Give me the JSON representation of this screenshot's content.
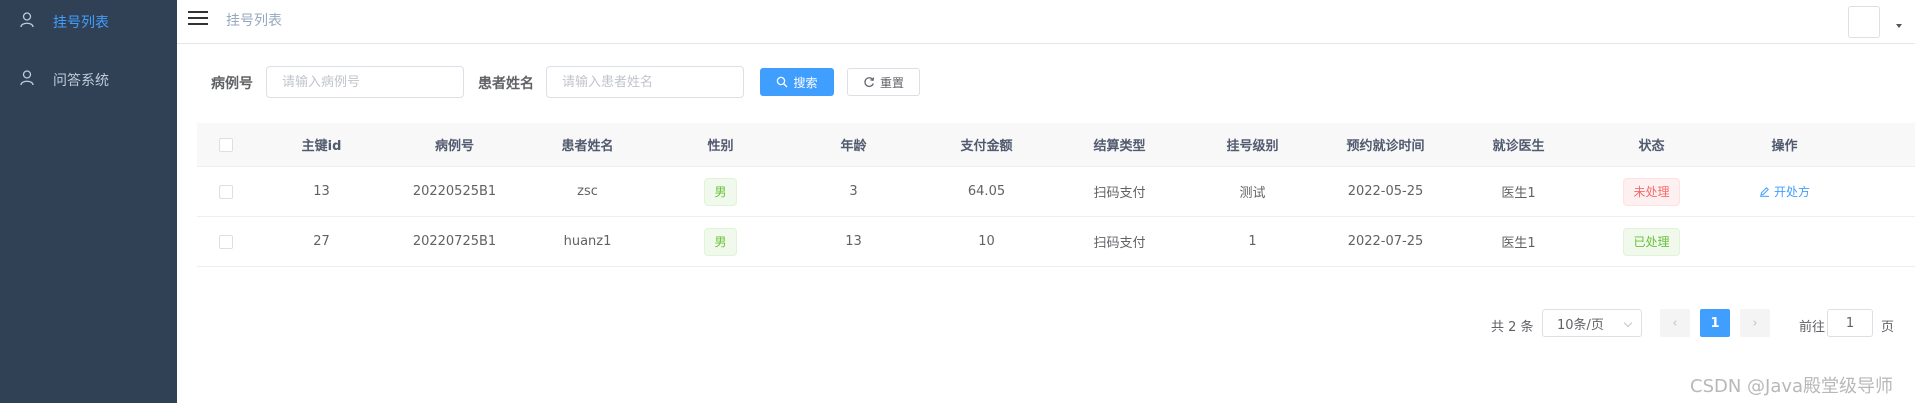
{
  "sidebar": {
    "items": [
      {
        "label": "挂号列表",
        "icon": "user-icon",
        "active": true
      },
      {
        "label": "问答系统",
        "icon": "user-icon",
        "active": false
      }
    ],
    "bg_color": "#304156",
    "active_color": "#409eff"
  },
  "navbar": {
    "breadcrumb": "挂号列表"
  },
  "search": {
    "case_label": "病例号",
    "case_placeholder": "请输入病例号",
    "case_value": "",
    "name_label": "患者姓名",
    "name_placeholder": "请输入患者姓名",
    "name_value": "",
    "search_button": "搜索",
    "reset_button": "重置"
  },
  "table": {
    "headers": [
      "主键id",
      "病例号",
      "患者姓名",
      "性别",
      "年龄",
      "支付金额",
      "结算类型",
      "挂号级别",
      "预约就诊时间",
      "就诊医生",
      "状态",
      "操作"
    ],
    "rows": [
      {
        "id": "13",
        "case_no": "20220525B1",
        "name": "zsc",
        "gender": "男",
        "age": "3",
        "amount": "64.05",
        "settle_type": "扫码支付",
        "level": "测试",
        "time": "2022-05-25",
        "doctor": "医生1",
        "status": "未处理",
        "status_type": "danger",
        "action": "开处方"
      },
      {
        "id": "27",
        "case_no": "20220725B1",
        "name": "huanz1",
        "gender": "男",
        "age": "13",
        "amount": "10",
        "settle_type": "扫码支付",
        "level": "1",
        "time": "2022-07-25",
        "doctor": "医生1",
        "status": "已处理",
        "status_type": "success",
        "action": ""
      }
    ]
  },
  "pagination": {
    "total": "共 2 条",
    "page_size": "10条/页",
    "current_page": "1",
    "goto_label": "前往",
    "goto_value": "1",
    "page_unit": "页"
  },
  "watermark": "CSDN @Java殿堂级导师"
}
